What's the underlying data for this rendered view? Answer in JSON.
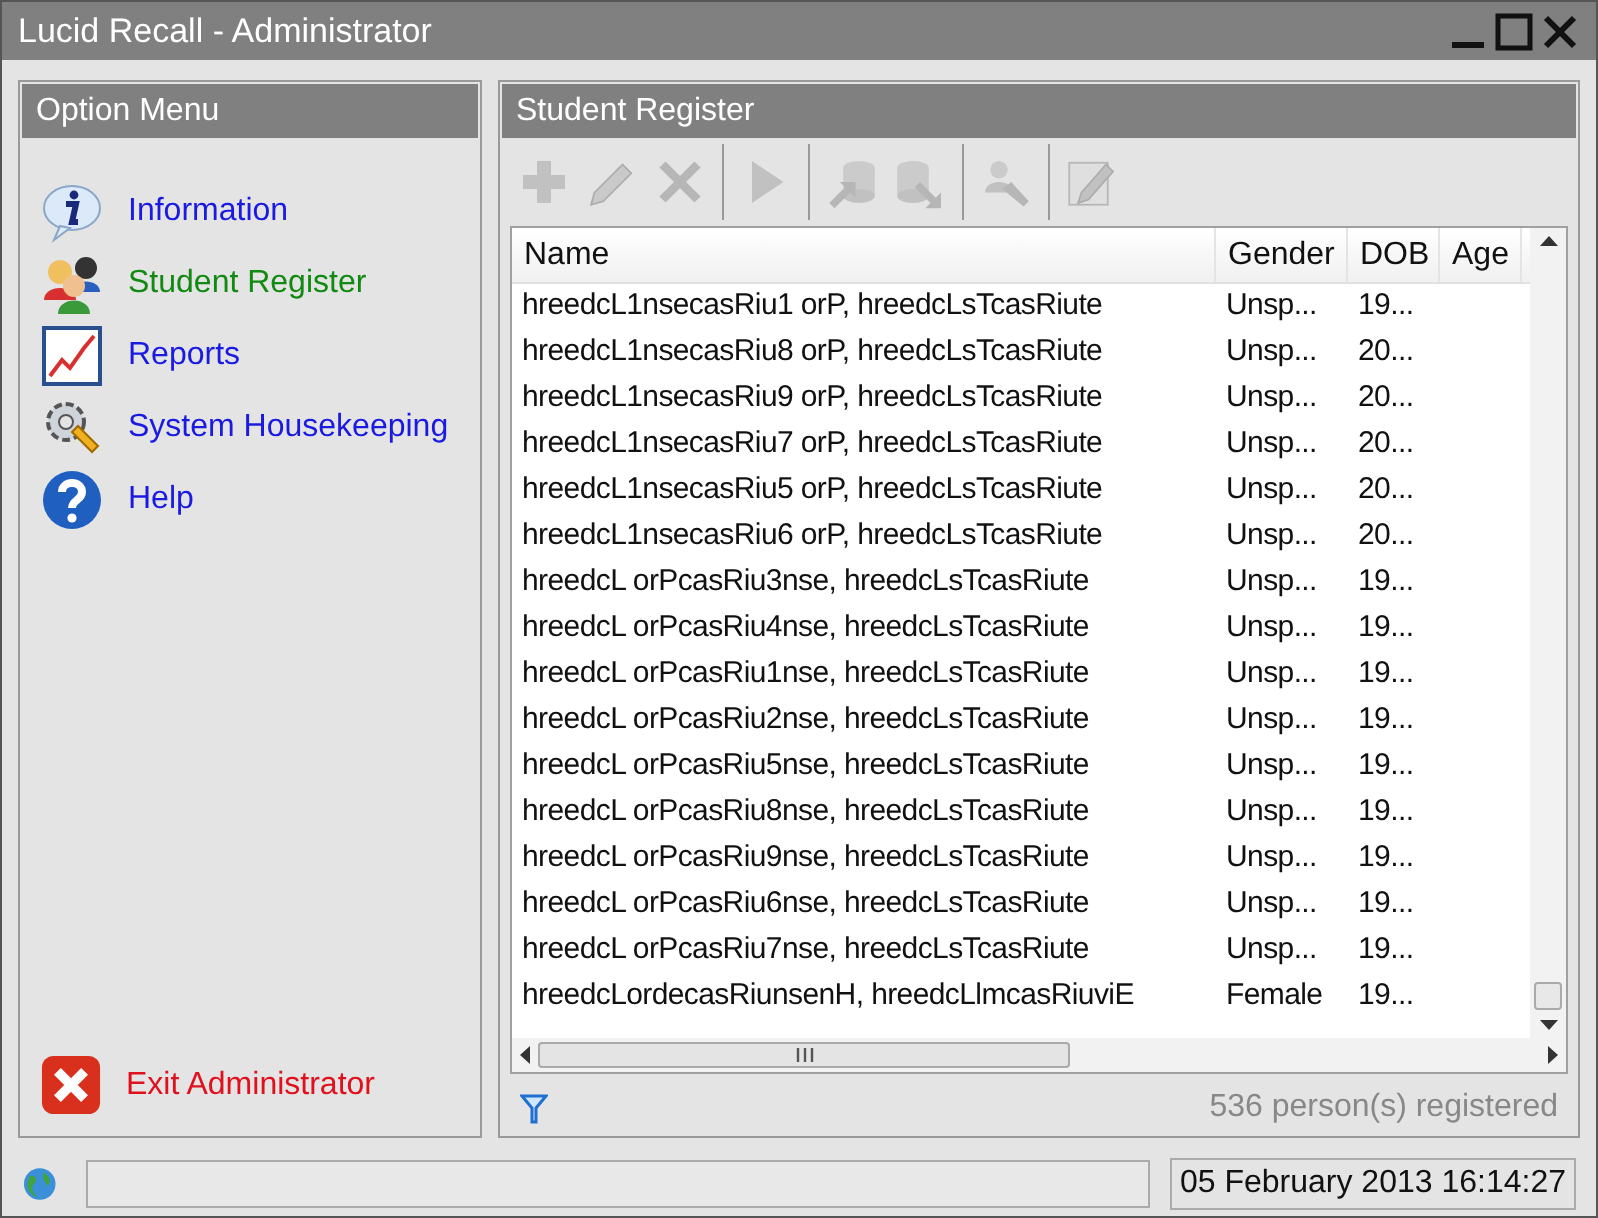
{
  "window": {
    "title": "Lucid Recall - Administrator"
  },
  "option_menu": {
    "title": "Option Menu",
    "items": [
      {
        "kind": "info",
        "label": "Information",
        "selected": false
      },
      {
        "kind": "people",
        "label": "Student Register",
        "selected": true
      },
      {
        "kind": "chart",
        "label": "Reports",
        "selected": false
      },
      {
        "kind": "gear",
        "label": "System Housekeeping",
        "selected": false
      },
      {
        "kind": "help",
        "label": "Help",
        "selected": false
      }
    ],
    "exit": {
      "label": "Exit Administrator"
    }
  },
  "register": {
    "title": "Student Register",
    "toolbar": [
      [
        {
          "kind": "add",
          "disabled": true
        },
        {
          "kind": "edit",
          "disabled": true
        },
        {
          "kind": "delete",
          "disabled": true
        }
      ],
      [
        {
          "kind": "run",
          "disabled": true
        }
      ],
      [
        {
          "kind": "import",
          "disabled": true
        },
        {
          "kind": "export",
          "disabled": true
        }
      ],
      [
        {
          "kind": "tools",
          "disabled": true
        }
      ],
      [
        {
          "kind": "notes",
          "disabled": true
        }
      ]
    ],
    "table": {
      "columns": [
        "Name",
        "Gender",
        "DOB",
        "Age"
      ],
      "rows": [
        [
          "hreedcL1nsecasRiu1 orP, hreedcLsTcasRiute",
          "Unsp...",
          "19..."
        ],
        [
          "hreedcL1nsecasRiu8 orP, hreedcLsTcasRiute",
          "Unsp...",
          "20..."
        ],
        [
          "hreedcL1nsecasRiu9 orP, hreedcLsTcasRiute",
          "Unsp...",
          "20..."
        ],
        [
          "hreedcL1nsecasRiu7 orP, hreedcLsTcasRiute",
          "Unsp...",
          "20..."
        ],
        [
          "hreedcL1nsecasRiu5 orP, hreedcLsTcasRiute",
          "Unsp...",
          "20..."
        ],
        [
          "hreedcL1nsecasRiu6 orP, hreedcLsTcasRiute",
          "Unsp...",
          "20..."
        ],
        [
          "hreedcL orPcasRiu3nse, hreedcLsTcasRiute",
          "Unsp...",
          "19..."
        ],
        [
          "hreedcL orPcasRiu4nse, hreedcLsTcasRiute",
          "Unsp...",
          "19..."
        ],
        [
          "hreedcL orPcasRiu1nse, hreedcLsTcasRiute",
          "Unsp...",
          "19..."
        ],
        [
          "hreedcL orPcasRiu2nse, hreedcLsTcasRiute",
          "Unsp...",
          "19..."
        ],
        [
          "hreedcL orPcasRiu5nse, hreedcLsTcasRiute",
          "Unsp...",
          "19..."
        ],
        [
          "hreedcL orPcasRiu8nse, hreedcLsTcasRiute",
          "Unsp...",
          "19..."
        ],
        [
          "hreedcL orPcasRiu9nse, hreedcLsTcasRiute",
          "Unsp...",
          "19..."
        ],
        [
          "hreedcL orPcasRiu6nse, hreedcLsTcasRiute",
          "Unsp...",
          "19..."
        ],
        [
          "hreedcL orPcasRiu7nse, hreedcLsTcasRiute",
          "Unsp...",
          "19..."
        ],
        [
          "hreedcLordecasRiunsenH, hreedcLlmcasRiuviE",
          "Female",
          "19..."
        ]
      ]
    },
    "count": "536 person(s) registered"
  },
  "status_bar": {
    "datetime": "05 February 2013 16:14:27"
  }
}
